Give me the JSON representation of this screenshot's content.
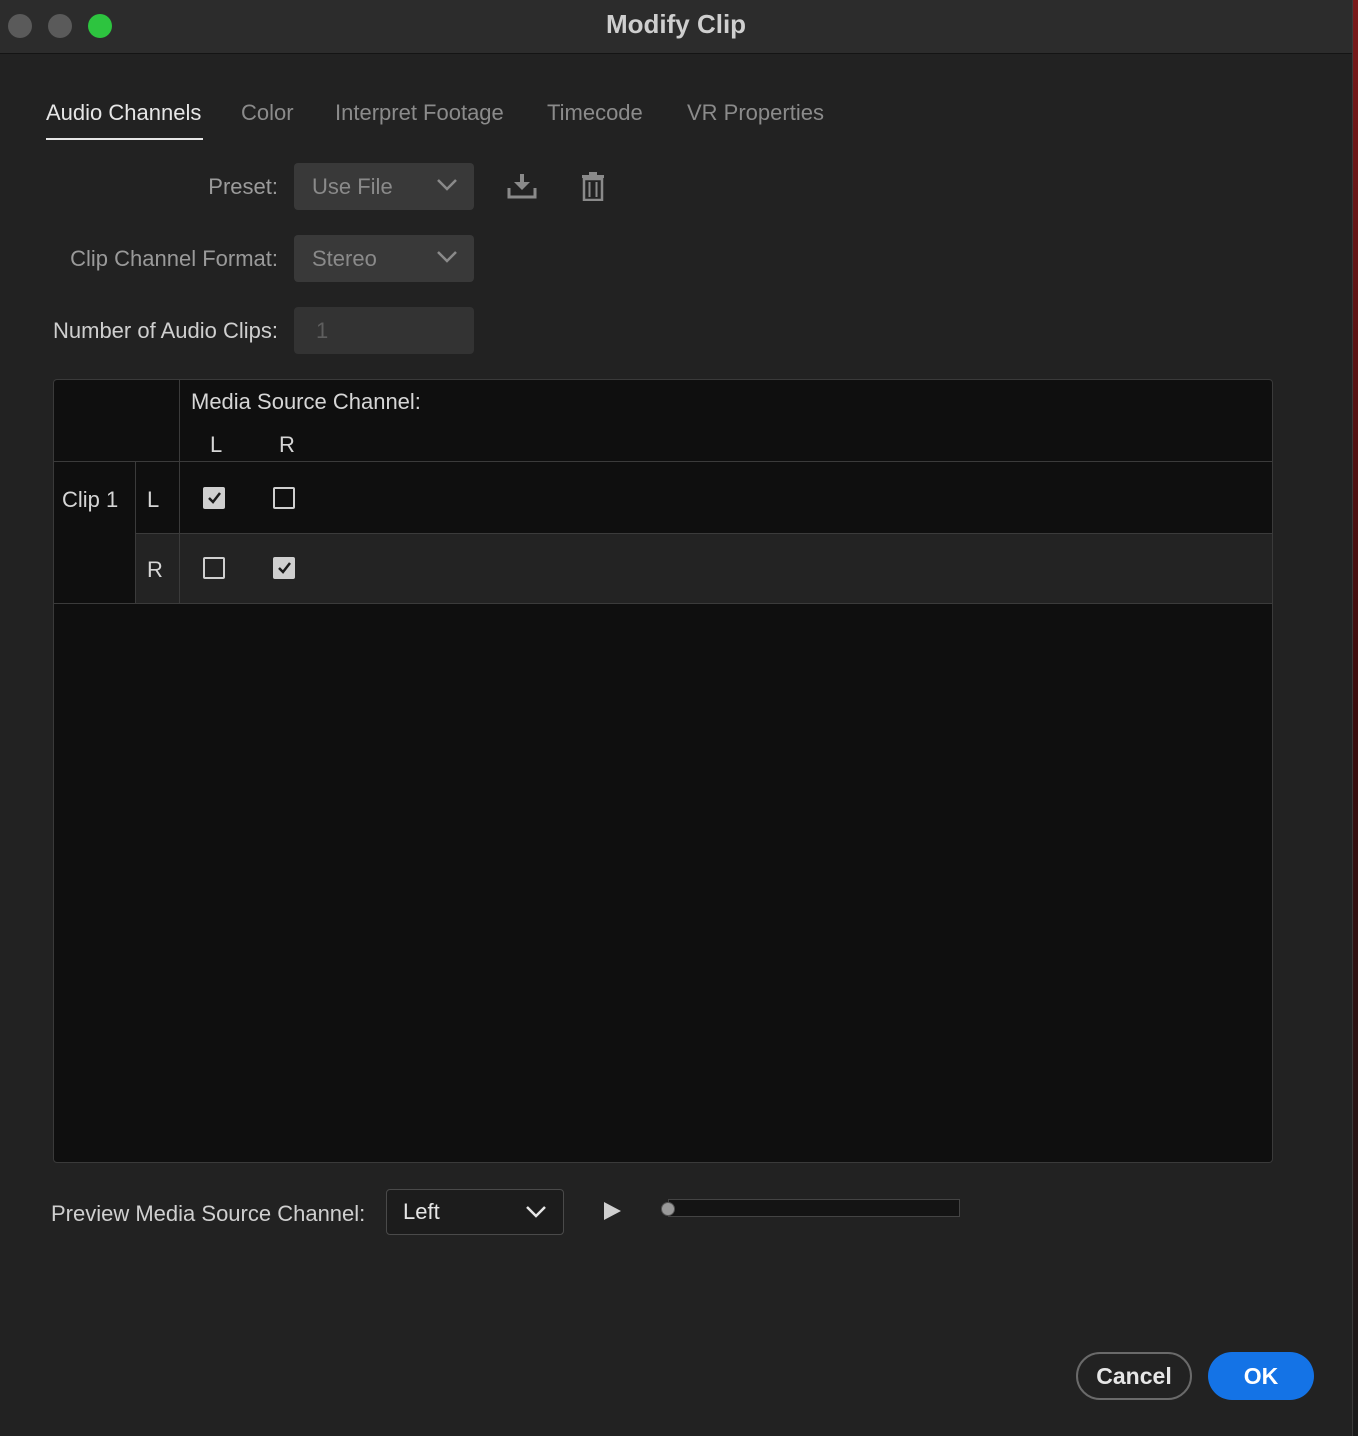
{
  "window": {
    "title": "Modify Clip"
  },
  "tabs": [
    {
      "label": "Audio Channels",
      "active": true
    },
    {
      "label": "Color",
      "active": false
    },
    {
      "label": "Interpret Footage",
      "active": false
    },
    {
      "label": "Timecode",
      "active": false
    },
    {
      "label": "VR Properties",
      "active": false
    }
  ],
  "preset": {
    "label": "Preset:",
    "value": "Use File",
    "icons": [
      "save-preset-icon",
      "trash-icon"
    ]
  },
  "format": {
    "label": "Clip Channel Format:",
    "value": "Stereo"
  },
  "clips": {
    "label": "Number of Audio Clips:",
    "value": "1"
  },
  "grid": {
    "header": "Media Source Channel:",
    "source_channels": [
      "L",
      "R"
    ],
    "clip_label": "Clip 1",
    "rows": [
      {
        "channel": "L",
        "checked": [
          true,
          false
        ]
      },
      {
        "channel": "R",
        "checked": [
          false,
          true
        ]
      }
    ]
  },
  "preview": {
    "label": "Preview Media Source Channel:",
    "value": "Left",
    "play_icon": "play-icon",
    "progress": 0
  },
  "buttons": {
    "cancel": "Cancel",
    "ok": "OK"
  },
  "colors": {
    "accent": "#1473e6",
    "maximize": "#2dc43f"
  }
}
